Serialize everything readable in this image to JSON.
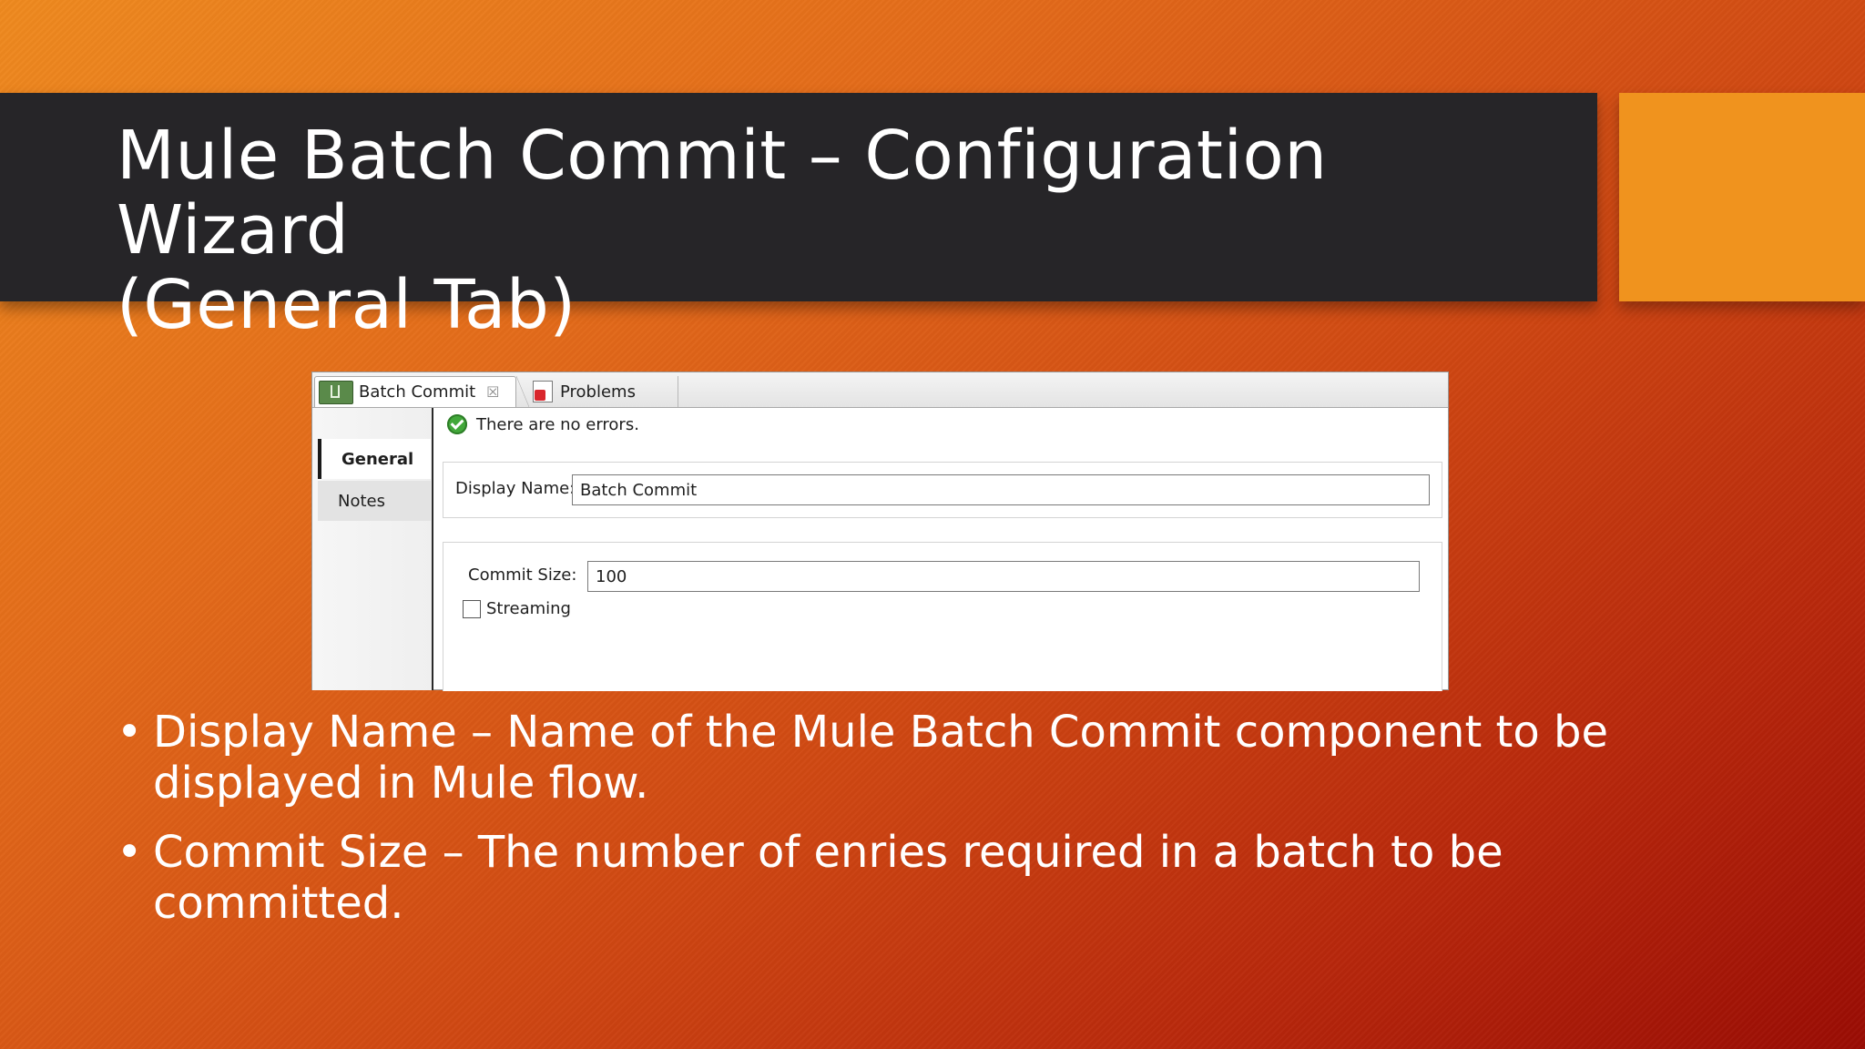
{
  "slide": {
    "title_line1": "Mule Batch Commit – Configuration Wizard",
    "title_line2": "(General Tab)",
    "bullets": [
      "Display Name – Name of the Mule Batch Commit component to be displayed in Mule flow.",
      "Commit Size – The number of enries required in a batch to be committed."
    ],
    "bullet_symbol": "•"
  },
  "editor": {
    "tabs": [
      {
        "label": "Batch Commit",
        "icon": "batch-commit-icon",
        "active": true,
        "close_glyph": "☒"
      },
      {
        "label": "Problems",
        "icon": "problems-icon",
        "active": false
      }
    ],
    "sidebar": [
      {
        "label": "General",
        "selected": true
      },
      {
        "label": "Notes",
        "selected": false
      }
    ],
    "status_message": "There are no errors.",
    "display_name": {
      "label": "Display Name:",
      "value": "Batch Commit"
    },
    "commit_size": {
      "label": "Commit Size:",
      "value": "100"
    },
    "streaming": {
      "label": "Streaming",
      "checked": false
    }
  },
  "colors": {
    "title_band": "#262528",
    "accent": "#f0931e",
    "background_start": "#ef8a1f",
    "background_end": "#9a0c04",
    "ok_green": "#42a83a"
  }
}
